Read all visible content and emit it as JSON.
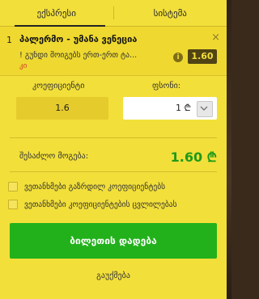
{
  "tabs": [
    {
      "label": "ექსპრესი",
      "active": true
    },
    {
      "label": "სისტემა",
      "active": false
    }
  ],
  "bet": {
    "index": "1",
    "title": "პალერმო - უმანა ვენეცია",
    "market": "! გუნდი მოიგებს ერთ-ერთ ტა...",
    "sub": "კი",
    "info_icon": "i",
    "odds": "1.60",
    "close": "×"
  },
  "coefficient": {
    "label": "კოეფიციენტი",
    "value": "1.6"
  },
  "amount": {
    "label": "ფსონი:",
    "value": "1 ₾"
  },
  "win": {
    "label": "შესაძლო მოგება:",
    "value": "1.60 ₾"
  },
  "options": [
    {
      "label": "ვეთანხმები გაზრდილ კოეფიციენტებს",
      "checked": false
    },
    {
      "label": "ვეთანხმები კოეფიციენტების ცვლილებას",
      "checked": false
    }
  ],
  "place_button": "ბილეთის დადება",
  "cancel": "გაუქმება",
  "colors": {
    "panel": "#f2df3a",
    "button": "#22b11b",
    "win": "#1f9a1a",
    "odds_badge": "#514414"
  }
}
